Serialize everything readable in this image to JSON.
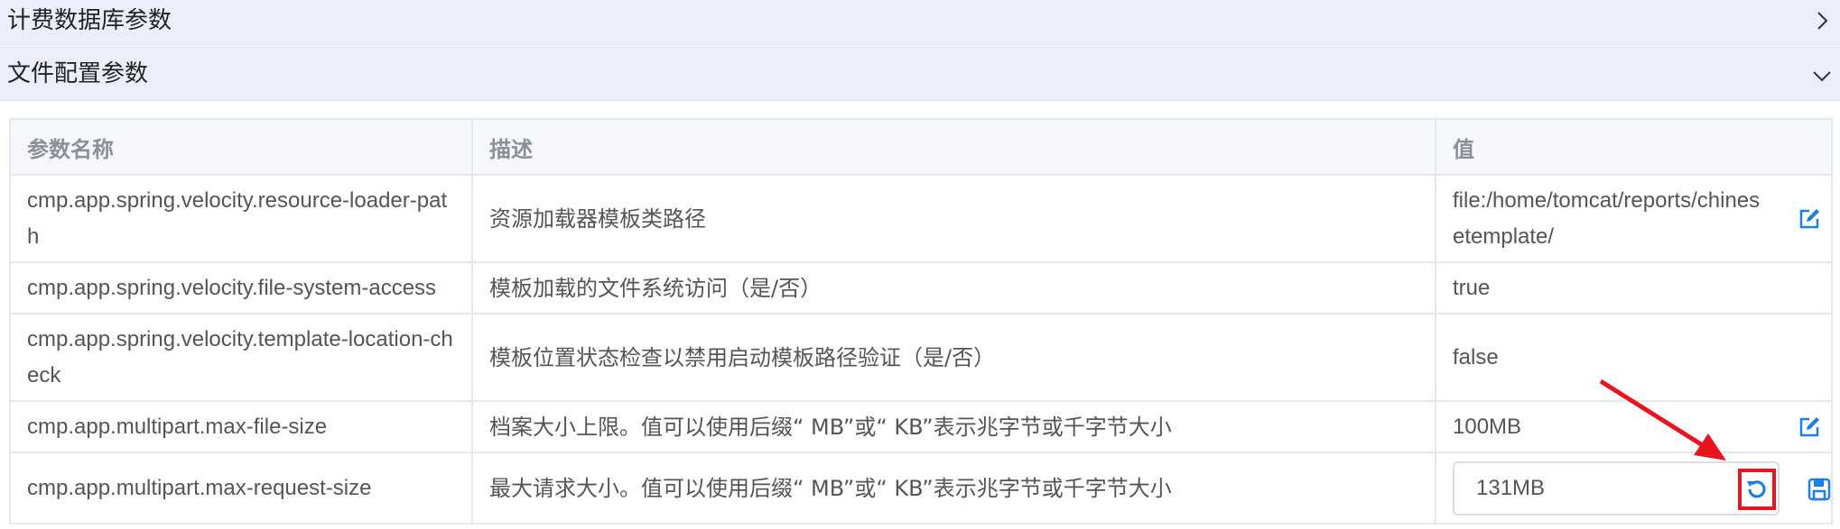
{
  "sections": {
    "billing_db": {
      "title": "计费数据库参数",
      "expanded": false
    },
    "file_config": {
      "title": "文件配置参数",
      "expanded": true
    }
  },
  "table": {
    "headers": {
      "name": "参数名称",
      "description": "描述",
      "value": "值"
    },
    "rows": [
      {
        "name": "cmp.app.spring.velocity.resource-loader-path",
        "description": "资源加载器模板类路径",
        "value": "file:/home/tomcat/reports/chinesetemplate/",
        "action": "edit"
      },
      {
        "name": "cmp.app.spring.velocity.file-system-access",
        "description": "模板加载的文件系统访问（是/否）",
        "value": "true",
        "action": "none"
      },
      {
        "name": "cmp.app.spring.velocity.template-location-check",
        "description": "模板位置状态检查以禁用启动模板路径验证（是/否）",
        "value": "false",
        "action": "none"
      },
      {
        "name": "cmp.app.multipart.max-file-size",
        "description": "档案大小上限。值可以使用后缀“ MB”或“ KB”表示兆字节或千字节大小",
        "value": "100MB",
        "action": "edit"
      },
      {
        "name": "cmp.app.multipart.max-request-size",
        "description": "最大请求大小。值可以使用后缀“ MB”或“ KB”表示兆字节或千字节大小",
        "value": "131MB",
        "action": "editing"
      }
    ]
  },
  "colors": {
    "section_bg": "#eceefb",
    "table_border": "#e3e8f0",
    "header_text": "#8a8f98",
    "icon_blue": "#1d7fe0",
    "highlight_red": "#e8141f"
  },
  "icons": {
    "collapsed_chevron": "chevron-right-icon",
    "expanded_chevron": "chevron-down-icon",
    "edit": "edit-icon",
    "reset": "reset-icon",
    "save": "save-icon"
  }
}
